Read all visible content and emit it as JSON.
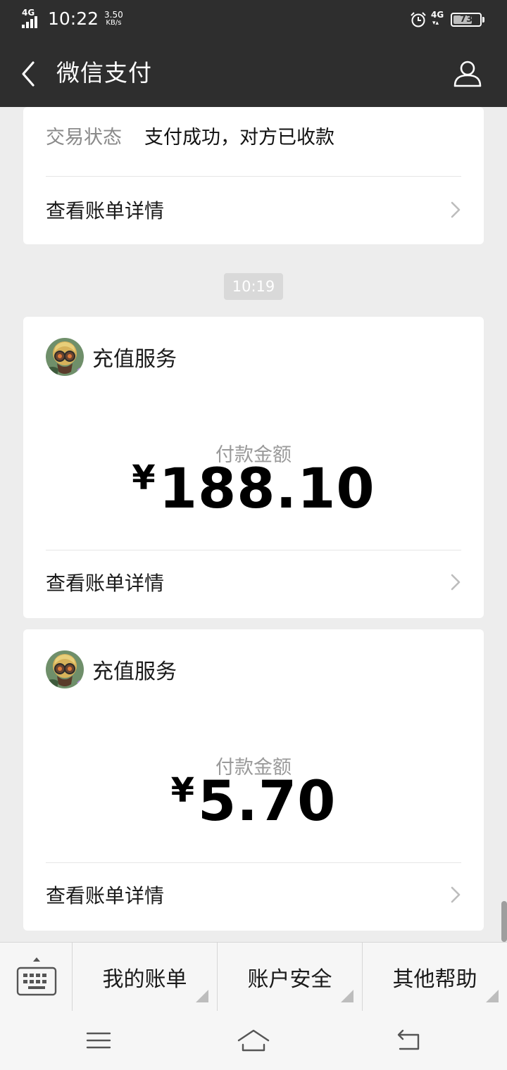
{
  "status_bar": {
    "network": "4G",
    "time": "10:22",
    "speed_value": "3.50",
    "speed_unit": "KB/s",
    "network_right": "4G",
    "battery": "73",
    "battery_level": 0.73
  },
  "header": {
    "title": "微信支付"
  },
  "top_card": {
    "status_label": "交易状态",
    "status_value": "支付成功，对方已收款",
    "link_label": "查看账单详情"
  },
  "timestamp": "10:19",
  "messages": [
    {
      "merchant": "充值服务",
      "amount_label": "付款金额",
      "currency": "¥",
      "amount": "188.10",
      "link_label": "查看账单详情"
    },
    {
      "merchant": "充值服务",
      "amount_label": "付款金额",
      "currency": "¥",
      "amount": "5.70",
      "link_label": "查看账单详情"
    }
  ],
  "bottom_menu": {
    "items": [
      "我的账单",
      "账户安全",
      "其他帮助"
    ]
  },
  "icons": {
    "back": "back-arrow-icon",
    "profile": "person-icon",
    "keyboard": "keyboard-icon",
    "chevron": "chevron-right-icon",
    "nav_menu": "menu-icon",
    "nav_home": "home-icon",
    "nav_back": "back-icon"
  },
  "colors": {
    "header_bg": "#2e2e2e",
    "page_bg": "#ededed",
    "card_bg": "#ffffff"
  }
}
